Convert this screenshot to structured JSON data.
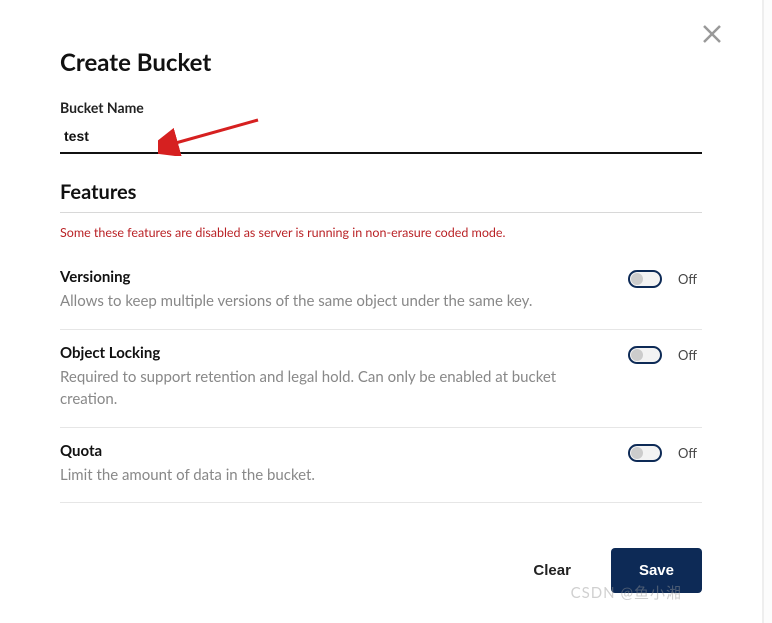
{
  "title": "Create Bucket",
  "bucketName": {
    "label": "Bucket Name",
    "value": "test"
  },
  "featuresSection": {
    "title": "Features",
    "warning": "Some these features are disabled as server is running in non-erasure coded mode."
  },
  "features": [
    {
      "name": "Versioning",
      "desc": "Allows to keep multiple versions of the same object under the same key.",
      "state": "Off"
    },
    {
      "name": "Object Locking",
      "desc": "Required to support retention and legal hold. Can only be enabled at bucket creation.",
      "state": "Off"
    },
    {
      "name": "Quota",
      "desc": "Limit the amount of data in the bucket.",
      "state": "Off"
    }
  ],
  "actions": {
    "clear": "Clear",
    "save": "Save"
  },
  "watermark": "CSDN @鱼小湘"
}
